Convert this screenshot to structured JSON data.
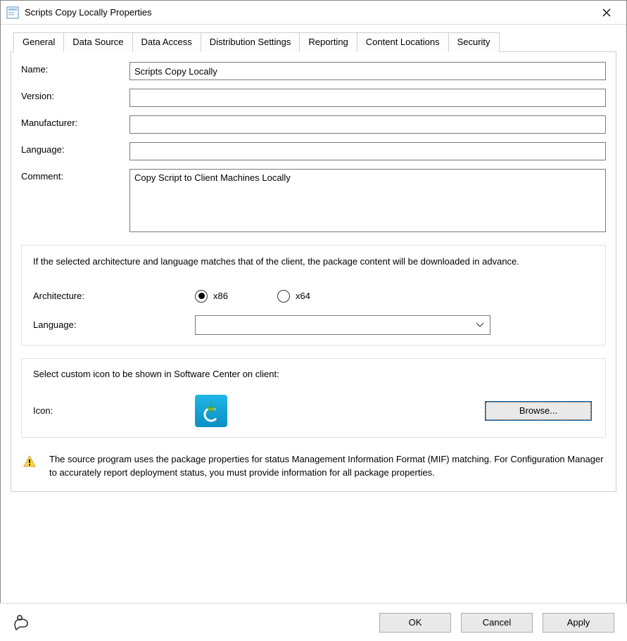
{
  "window": {
    "title": "Scripts Copy Locally Properties"
  },
  "tabs": [
    "General",
    "Data Source",
    "Data Access",
    "Distribution Settings",
    "Reporting",
    "Content Locations",
    "Security"
  ],
  "active_tab": 0,
  "form": {
    "name_label": "Name:",
    "name_value": "Scripts Copy Locally",
    "version_label": "Version:",
    "version_value": "",
    "manufacturer_label": "Manufacturer:",
    "manufacturer_value": "",
    "language_label": "Language:",
    "language_value": "",
    "comment_label": "Comment:",
    "comment_value": "Copy Script to Client Machines Locally"
  },
  "arch_panel": {
    "info": "If the selected architecture and language matches that of the client, the package content will be downloaded in advance.",
    "architecture_label": "Architecture:",
    "arch_options": {
      "x86": "x86",
      "x64": "x64"
    },
    "arch_selected": "x86",
    "language_label": "Language:",
    "language_selected": ""
  },
  "icon_panel": {
    "prompt": "Select custom icon to be shown in Software Center on client:",
    "icon_label": "Icon:",
    "browse_label": "Browse..."
  },
  "warning_text": "The source program uses the package properties for status Management Information Format (MIF) matching. For Configuration Manager to accurately report deployment status, you must provide information for all package properties.",
  "buttons": {
    "ok": "OK",
    "cancel": "Cancel",
    "apply": "Apply"
  }
}
